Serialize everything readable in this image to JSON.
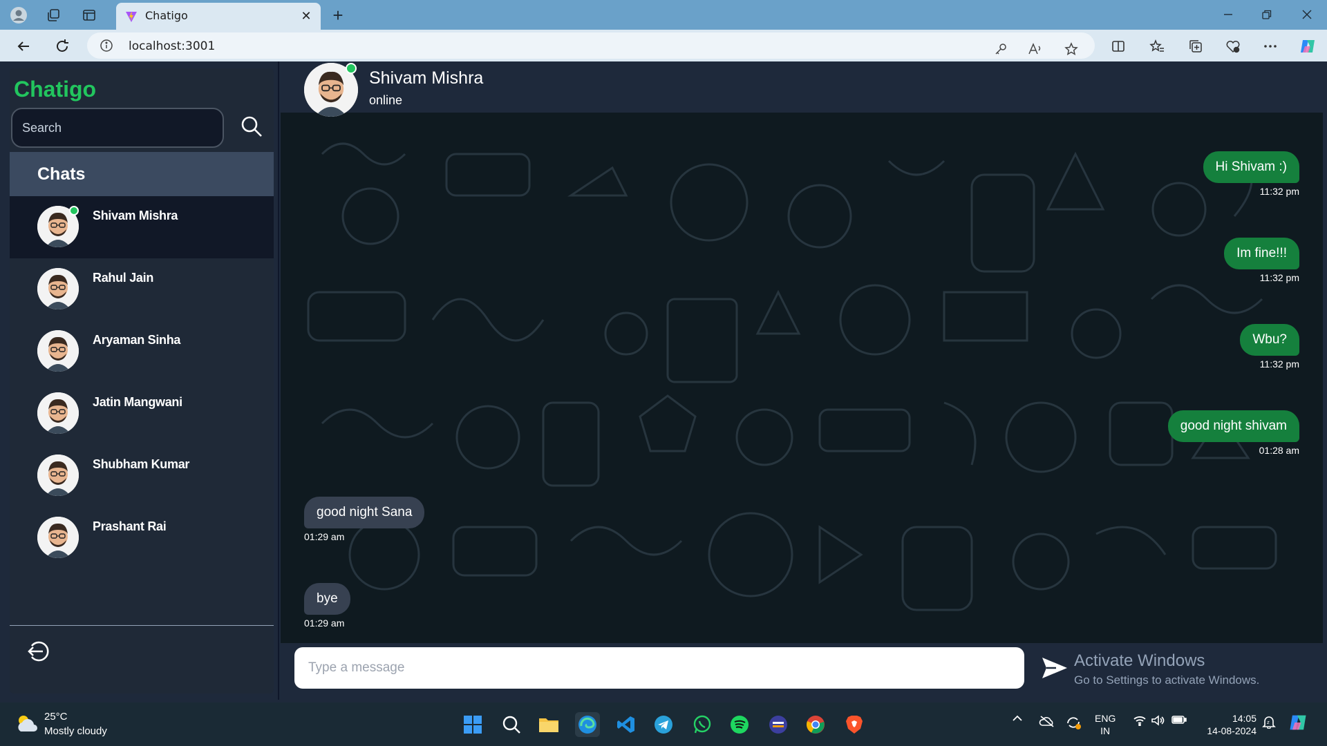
{
  "browser": {
    "tab_title": "Chatigo",
    "url": "localhost:3001",
    "new_tab_symbol": "+",
    "close_symbol": "✕"
  },
  "app": {
    "brand": "Chatigo",
    "search_placeholder": "Search",
    "chats_title": "Chats",
    "contacts": [
      {
        "name": "Shivam Mishra",
        "online": true,
        "active": true
      },
      {
        "name": "Rahul Jain",
        "online": false,
        "active": false
      },
      {
        "name": "Aryaman Sinha",
        "online": false,
        "active": false
      },
      {
        "name": "Jatin Mangwani",
        "online": false,
        "active": false
      },
      {
        "name": "Shubham Kumar",
        "online": false,
        "active": false
      },
      {
        "name": "Prashant Rai",
        "online": false,
        "active": false
      }
    ],
    "header": {
      "name": "Shivam Mishra",
      "status": "online"
    },
    "messages": [
      {
        "text": "Hi Shivam :)",
        "time": "11:32 pm",
        "direction": "sent"
      },
      {
        "text": "Im fine!!!",
        "time": "11:32 pm",
        "direction": "sent"
      },
      {
        "text": "Wbu?",
        "time": "11:32 pm",
        "direction": "sent"
      },
      {
        "text": "good night shivam",
        "time": "01:28 am",
        "direction": "sent"
      },
      {
        "text": "good night Sana",
        "time": "01:29 am",
        "direction": "received"
      },
      {
        "text": "bye",
        "time": "01:29 am",
        "direction": "received"
      }
    ],
    "input_placeholder": "Type a message",
    "watermark_title": "Activate Windows",
    "watermark_subtitle": "Go to Settings to activate Windows."
  },
  "taskbar": {
    "temperature": "25°C",
    "weather": "Mostly cloudy",
    "language_top": "ENG",
    "language_bottom": "IN",
    "time": "14:05",
    "date": "14-08-2024"
  },
  "colors": {
    "accent_green": "#22c55e",
    "sent_bubble": "#15803d",
    "received_bubble": "#374151",
    "sidebar_bg": "#1f2937",
    "chat_bg": "#0f1a20"
  }
}
